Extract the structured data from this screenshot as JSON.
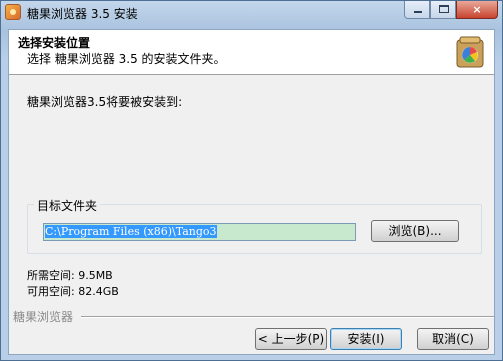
{
  "window": {
    "title": "糖果浏览器 3.5 安装",
    "controls": {
      "minimize": "minimize",
      "maximize": "maximize",
      "close": "×"
    }
  },
  "header": {
    "title": "选择安装位置",
    "subtitle": "选择 糖果浏览器 3.5 的安装文件夹。"
  },
  "body": {
    "install_to_label": "糖果浏览器3.5将要被安装到:",
    "target_folder_label": "目标文件夹",
    "target_folder_value": "C:\\Program Files (x86)\\Tango3",
    "browse_label": "浏览(B)...",
    "space_required": "所需空间: 9.5MB",
    "space_available": "可用空间: 82.4GB"
  },
  "footer": {
    "branding": "糖果浏览器",
    "back_label": "< 上一步(P)",
    "install_label": "安装(I)",
    "cancel_label": "取消(C)"
  },
  "colors": {
    "titlebar": "#b9cfe7",
    "path_highlight": "#3399ff",
    "path_field_bg": "#c9e9cf"
  }
}
